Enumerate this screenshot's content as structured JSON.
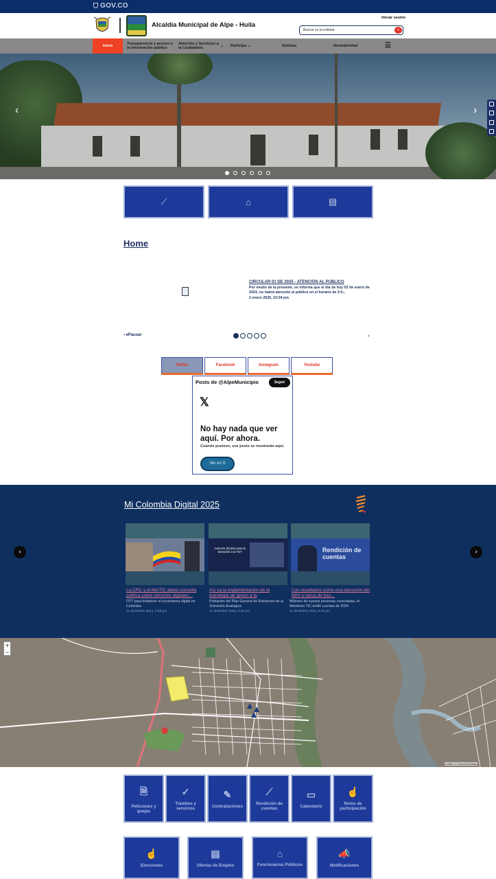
{
  "gov_logo": "GOV.CO",
  "header": {
    "title": "Alcaldía Municipal de Alpe - Huila",
    "login": "Iniciar sesión",
    "search_placeholder": "Buscar en la entidad"
  },
  "nav": {
    "items": [
      {
        "label": "Inicio"
      },
      {
        "label": "Transparencia y acceso a la información pública"
      },
      {
        "label": "Atención y Servicios a la Ciudadanía"
      },
      {
        "label": "Participa"
      },
      {
        "label": "Noticias"
      },
      {
        "label": "Normatividad"
      }
    ]
  },
  "hero": {
    "slides": 6,
    "active_slide": 1
  },
  "home": {
    "title": "Home",
    "news_title": "CIRCULAR 01 DE 2025 - ATENCIÓN AL PUBLICO",
    "news_body": "Por medio de la presente, se informa que el día de hoy 02 de enero de 2024, no habrá atención al público en el horario de 2:0...",
    "news_date": "2 enero 2025, 10:04 pm",
    "prev_label": "Pausar",
    "pager_dots": 5
  },
  "social": {
    "tabs": [
      "Twitter",
      "Facebook",
      "Instagram",
      "Youtube"
    ],
    "active_tab": "Twitter",
    "posts_header": "Posts de @AlpeMunicipio",
    "follow_label": "Seguir",
    "x_logo": "𝕏",
    "empty_title": "No hay nada que ver aquí. Por ahora.",
    "empty_sub": "Cuando posteen, sus posts se mostrarán aquí.",
    "view_button": "Ver en X"
  },
  "mi_colombia": {
    "title": "Mi Colombia Digital 2025",
    "cards": [
      {
        "title": "La CRC y el MinTIC abren consulta pública sobre servicios digitales...",
        "desc": "OTT para fortalecer el ecosistema digital en Colombia",
        "date": "11 diciembre 2024, 4:59 pm"
      },
      {
        "title": "Así va la implementación de la estrategia de apoyo a la",
        "desc": "Población del Plan General de Emisiones de la Televisión Analógica",
        "date": "11 diciembre 2024, 5:00 pm"
      },
      {
        "title": "Con resultados como una ejecución del 88% y cerca de tres...",
        "desc": "Millones de nuevas personas conectadas, el Ministerio TIC rindió cuentas de 2024",
        "date": "11 diciembre 2024, 5:01 pm"
      }
    ],
    "card2_overlay": "Avances del plan para la transición a la TDT",
    "card3_overlay": "Rendición de cuentas"
  },
  "map": {
    "zoom_in": "+",
    "zoom_out": "−",
    "attribution": "Leaflet | © OpenStreetMap"
  },
  "tiles_row1": [
    {
      "label": "Peticiones y quejas",
      "icon": "document-icon"
    },
    {
      "label": "Trámites y servicios",
      "icon": "check-icon"
    },
    {
      "label": "Contrataciones",
      "icon": "contract-icon"
    },
    {
      "label": "Rendición de cuentas",
      "icon": "chart-icon"
    },
    {
      "label": "Calendario",
      "icon": "calendar-icon"
    },
    {
      "label": "Retos de participación",
      "icon": "hand-icon"
    }
  ],
  "tiles_row2": [
    {
      "label": "Elecciones",
      "icon": "vote-icon"
    },
    {
      "label": "Ofertas de Empleo",
      "icon": "jobs-icon"
    },
    {
      "label": "Funcionarios Públicos",
      "icon": "building-icon"
    },
    {
      "label": "Notificaciones",
      "icon": "megaphone-icon"
    }
  ]
}
